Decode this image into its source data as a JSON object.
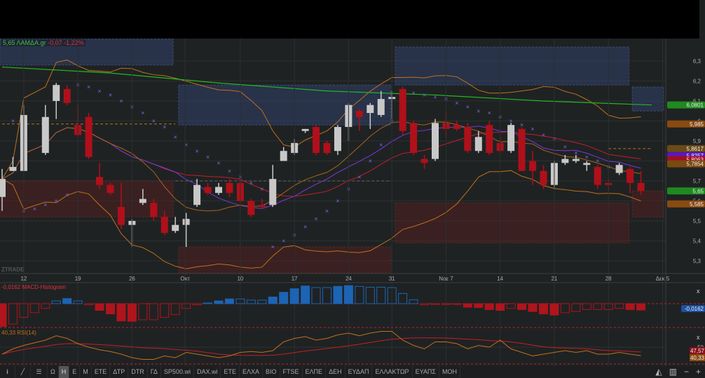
{
  "header": {
    "price": "5,65",
    "symbol": "ΛΑΜΔΑ.gr",
    "change": "-0,07",
    "change_pct": "-1,22%"
  },
  "watermark": "ZTRADE",
  "macd_label": "-0,0162 MACD-Histogram",
  "rsi_label": "40,33 RSI(14)",
  "close_symbol": "x",
  "colors": {
    "bg": "#1f2223",
    "grid": "#2c3031",
    "up": "#c8c8c8",
    "down": "#b0101a",
    "green_ma": "#22b822",
    "band": "#c0701a",
    "ma_purple": "#7a3ad8",
    "ma_red": "#c0202a",
    "sar": "#7a6ae0",
    "macd_up": "#1c64b4",
    "macd_down": "#b0141c",
    "rsi": "#c0701a",
    "rsi_ma": "#c0202a"
  },
  "chart_data": {
    "type": "candlestick",
    "title": "ΛΑΜΔΑ.gr",
    "y_ticks": [
      "6,3",
      "6,2",
      "6,1",
      "6",
      "5,9",
      "5,8",
      "5,7",
      "5,6",
      "5,5",
      "5,4",
      "5,3"
    ],
    "y_tick_values": [
      6.3,
      6.2,
      6.1,
      6.0,
      5.9,
      5.8,
      5.7,
      5.6,
      5.5,
      5.4,
      5.3
    ],
    "x_ticks": [
      {
        "d": 2,
        "label": "12"
      },
      {
        "d": 7,
        "label": "19"
      },
      {
        "d": 12,
        "label": "26"
      },
      {
        "d": 16.9,
        "label": "Οκτ"
      },
      {
        "d": 22,
        "label": "10"
      },
      {
        "d": 27,
        "label": "17"
      },
      {
        "d": 32,
        "label": "24"
      },
      {
        "d": 36,
        "label": "31"
      },
      {
        "d": 41,
        "label": "Νοε 7"
      },
      {
        "d": 46,
        "label": "14"
      },
      {
        "d": 51,
        "label": "21"
      },
      {
        "d": 56,
        "label": "28"
      },
      {
        "d": 61,
        "label": "Δεκ 5"
      }
    ],
    "candles_ohlc": [
      [
        0,
        5.62,
        5.76,
        5.55,
        5.71
      ],
      [
        1,
        5.75,
        5.82,
        5.75,
        5.77
      ],
      [
        2,
        5.75,
        6.08,
        5.75,
        6.03
      ],
      [
        4,
        5.84,
        6.08,
        5.83,
        6.02
      ],
      [
        5,
        6.1,
        6.19,
        6.01,
        6.18
      ],
      [
        6,
        6.16,
        6.18,
        6.08,
        6.09
      ],
      [
        7,
        5.98,
        6.08,
        5.92,
        5.93
      ],
      [
        8,
        6.02,
        6.04,
        5.81,
        5.82
      ],
      [
        9,
        5.72,
        5.79,
        5.66,
        5.68
      ],
      [
        10,
        5.68,
        5.69,
        5.63,
        5.64
      ],
      [
        11,
        5.57,
        5.69,
        5.46,
        5.48
      ],
      [
        12,
        5.48,
        5.51,
        5.37,
        5.5
      ],
      [
        13,
        5.59,
        5.66,
        5.58,
        5.61
      ],
      [
        14,
        5.59,
        5.61,
        5.5,
        5.52
      ],
      [
        15,
        5.52,
        5.55,
        5.43,
        5.44
      ],
      [
        16,
        5.45,
        5.52,
        5.44,
        5.48
      ],
      [
        17,
        5.48,
        5.54,
        5.37,
        5.51
      ],
      [
        18,
        5.58,
        5.71,
        5.57,
        5.68
      ],
      [
        19,
        5.67,
        5.69,
        5.63,
        5.64
      ],
      [
        20,
        5.64,
        5.69,
        5.63,
        5.67
      ],
      [
        21,
        5.69,
        5.71,
        5.62,
        5.64
      ],
      [
        22,
        5.69,
        5.7,
        5.59,
        5.6
      ],
      [
        23,
        5.6,
        5.61,
        5.52,
        5.53
      ],
      [
        24,
        5.58,
        5.61,
        5.56,
        5.57
      ],
      [
        25,
        5.58,
        5.78,
        5.57,
        5.71
      ],
      [
        26,
        5.8,
        5.87,
        5.8,
        5.85
      ],
      [
        27,
        5.84,
        5.91,
        5.83,
        5.89
      ],
      [
        28,
        5.95,
        5.96,
        5.94,
        5.96
      ],
      [
        29,
        5.97,
        5.98,
        5.83,
        5.84
      ],
      [
        30,
        5.89,
        5.9,
        5.83,
        5.84
      ],
      [
        31,
        5.85,
        5.98,
        5.83,
        5.97
      ],
      [
        32,
        5.97,
        6.09,
        5.9,
        6.08
      ],
      [
        33,
        6.05,
        6.06,
        5.95,
        6.02
      ],
      [
        34,
        6.04,
        6.09,
        5.96,
        6.08
      ],
      [
        35,
        6.03,
        6.15,
        6.02,
        6.11
      ],
      [
        36,
        6.11,
        6.15,
        6.01,
        6.12
      ],
      [
        37,
        6.16,
        6.17,
        5.93,
        5.95
      ],
      [
        38,
        5.99,
        6.0,
        5.83,
        5.84
      ],
      [
        39,
        5.81,
        5.83,
        5.76,
        5.79
      ],
      [
        40,
        5.81,
        6.01,
        5.8,
        5.99
      ],
      [
        41,
        5.99,
        6.04,
        5.92,
        5.96
      ],
      [
        42,
        5.98,
        6.0,
        5.95,
        5.96
      ],
      [
        43,
        5.97,
        5.99,
        5.84,
        5.85
      ],
      [
        44,
        5.85,
        5.95,
        5.84,
        5.92
      ],
      [
        45,
        5.98,
        6.0,
        5.83,
        5.84
      ],
      [
        46,
        5.89,
        5.92,
        5.84,
        5.85
      ],
      [
        47,
        5.85,
        5.99,
        5.84,
        5.98
      ],
      [
        48,
        5.96,
        5.97,
        5.75,
        5.75
      ],
      [
        49,
        5.8,
        5.85,
        5.68,
        5.75
      ],
      [
        50,
        5.75,
        5.78,
        5.66,
        5.68
      ],
      [
        51,
        5.68,
        5.8,
        5.66,
        5.79
      ],
      [
        52,
        5.79,
        5.83,
        5.78,
        5.81
      ],
      [
        53,
        5.8,
        5.83,
        5.79,
        5.81
      ],
      [
        54,
        5.78,
        5.8,
        5.75,
        5.79
      ],
      [
        55,
        5.77,
        5.78,
        5.66,
        5.68
      ],
      [
        56,
        5.69,
        5.71,
        5.65,
        5.68
      ],
      [
        57,
        5.74,
        5.79,
        5.73,
        5.78
      ],
      [
        58,
        5.76,
        5.77,
        5.64,
        5.69
      ],
      [
        59,
        5.69,
        5.75,
        5.63,
        5.65
      ]
    ],
    "long_ma": [
      [
        0,
        6.27
      ],
      [
        10,
        6.24
      ],
      [
        20,
        6.19
      ],
      [
        30,
        6.15
      ],
      [
        40,
        6.13
      ],
      [
        50,
        6.1
      ],
      [
        60,
        6.08
      ]
    ],
    "sar": [
      [
        1,
        6.0
      ],
      [
        2,
        5.55
      ],
      [
        3,
        5.56
      ],
      [
        4,
        5.58
      ],
      [
        5,
        5.6
      ],
      [
        6,
        5.63
      ],
      [
        7,
        6.18
      ],
      [
        8,
        6.17
      ],
      [
        9,
        6.15
      ],
      [
        10,
        6.13
      ],
      [
        11,
        6.1
      ],
      [
        12,
        6.07
      ],
      [
        13,
        6.04
      ],
      [
        14,
        6.0
      ],
      [
        15,
        5.97
      ],
      [
        16,
        5.92
      ],
      [
        17,
        5.88
      ],
      [
        18,
        5.85
      ],
      [
        19,
        5.82
      ],
      [
        20,
        5.79
      ],
      [
        21,
        5.75
      ],
      [
        22,
        5.72
      ],
      [
        23,
        5.69
      ],
      [
        24,
        5.66
      ],
      [
        25,
        5.37
      ],
      [
        26,
        5.4
      ],
      [
        27,
        5.43
      ],
      [
        28,
        5.47
      ],
      [
        29,
        5.51
      ],
      [
        30,
        5.55
      ],
      [
        31,
        5.6
      ],
      [
        32,
        5.66
      ],
      [
        33,
        5.72
      ],
      [
        34,
        5.8
      ],
      [
        35,
        5.88
      ],
      [
        36,
        6.0
      ],
      [
        37,
        6.15
      ],
      [
        38,
        6.14
      ],
      [
        39,
        6.13
      ],
      [
        40,
        6.12
      ],
      [
        41,
        6.11
      ],
      [
        42,
        6.09
      ],
      [
        43,
        6.07
      ],
      [
        44,
        6.05
      ],
      [
        45,
        6.04
      ],
      [
        46,
        6.02
      ],
      [
        47,
        6.0
      ],
      [
        48,
        5.98
      ],
      [
        49,
        5.96
      ],
      [
        50,
        5.93
      ],
      [
        51,
        5.91
      ],
      [
        52,
        5.87
      ],
      [
        53,
        5.84
      ],
      [
        54,
        5.82
      ],
      [
        55,
        5.8
      ],
      [
        56,
        5.77
      ]
    ],
    "zones": [
      {
        "kind": "supply",
        "d0": -0.2,
        "d1": 15.8,
        "p0": 6.41,
        "p1": 6.28
      },
      {
        "kind": "supply",
        "d0": 16.3,
        "d1": 35.9,
        "p0": 6.18,
        "p1": 5.98
      },
      {
        "kind": "supply",
        "d0": 36.3,
        "d1": 57.9,
        "p0": 6.37,
        "p1": 6.18
      },
      {
        "kind": "supply",
        "d0": 58.2,
        "d1": 61.1,
        "p0": 6.17,
        "p1": 6.05
      },
      {
        "kind": "demand",
        "d0": -0.2,
        "d1": 15.8,
        "p0": 5.7,
        "p1": 5.52
      },
      {
        "kind": "demand",
        "d0": 16.3,
        "d1": 35.9,
        "p0": 5.37,
        "p1": 5.24
      },
      {
        "kind": "demand",
        "d0": 36.3,
        "d1": 57.9,
        "p0": 5.59,
        "p1": 5.39
      },
      {
        "kind": "demand",
        "d0": 58.2,
        "d1": 61.1,
        "p0": 5.65,
        "p1": 5.52
      }
    ],
    "price_tags": [
      {
        "p": 6.0801,
        "label": "6,0801",
        "color": "#1f8a1f"
      },
      {
        "p": 5.985,
        "label": "5,985",
        "color": "#8a4a10"
      },
      {
        "p": 5.8617,
        "label": "5,8617",
        "color": "#6a4a18"
      },
      {
        "p": 5.8257,
        "label": "5,8257",
        "color": "#5a18c0"
      },
      {
        "p": 5.8063,
        "label": "5,8063",
        "color": "#a01020"
      },
      {
        "p": 5.7854,
        "label": "5,7854",
        "color": "#7a4a10"
      },
      {
        "p": 5.65,
        "label": "5,65",
        "color": "#1f8a1f"
      },
      {
        "p": 5.585,
        "label": "5,585",
        "color": "#8a4a10"
      }
    ],
    "macd_hist": [
      -0.058,
      -0.052,
      -0.035,
      -0.023,
      -0.012,
      0.007,
      0.013,
      0.007,
      -0.003,
      -0.017,
      -0.026,
      -0.044,
      -0.045,
      -0.041,
      -0.041,
      -0.035,
      -0.028,
      -0.012,
      -0.003,
      0.002,
      0.007,
      0.012,
      0.012,
      0.009,
      0.009,
      0.017,
      0.029,
      0.038,
      0.045,
      0.041,
      0.041,
      0.044,
      0.046,
      0.044,
      0.042,
      0.042,
      0.041,
      0.026,
      0.01,
      -0.003,
      -0.002,
      -0.002,
      -0.002,
      -0.009,
      -0.01,
      -0.015,
      -0.017,
      -0.012,
      -0.015,
      -0.02,
      -0.026,
      -0.029,
      -0.023,
      -0.02,
      -0.015,
      -0.015,
      -0.015,
      -0.012,
      -0.015,
      -0.0162
    ],
    "macd_tag": "-0,0162",
    "rsi": [
      42,
      48,
      52,
      55,
      58,
      63,
      60,
      54,
      50,
      47,
      45,
      42,
      38,
      36,
      36,
      40,
      38,
      44,
      42,
      40,
      38,
      40,
      44,
      45,
      44,
      46,
      56,
      60,
      62,
      58,
      60,
      64,
      66,
      63,
      66,
      68,
      68,
      58,
      52,
      48,
      56,
      56,
      54,
      48,
      52,
      50,
      58,
      48,
      44,
      40,
      42,
      44,
      46,
      44,
      46,
      42,
      42,
      44,
      42,
      40.33
    ],
    "rsi_ma_tag": "47,57",
    "rsi_tag": "40,33",
    "rsi_level": "50"
  },
  "toolbar": {
    "items": [
      "Ω",
      "Η",
      "Ε",
      "Μ",
      "ΕΤΕ",
      "ΔΤΡ",
      "DTR",
      "ΓΔ",
      "SP500.wi",
      "DAX.wi",
      "ΕΤΕ",
      "ΕΛΧΑ",
      "ΒΙΟ",
      "FTSE",
      "ΕΛΠΕ",
      "ΔΕΗ",
      "ΕΥΔΑΠ",
      "ΕΛΛΑΚΤΩΡ",
      "ΕΥΑΠΣ",
      "ΜΟΗ"
    ],
    "active": "Η",
    "icons": {
      "info": "i",
      "draw": "╱",
      "lines": "☰"
    },
    "right": {
      "area": "◭",
      "bars": "▥",
      "minus": "−",
      "plus": "+"
    }
  }
}
